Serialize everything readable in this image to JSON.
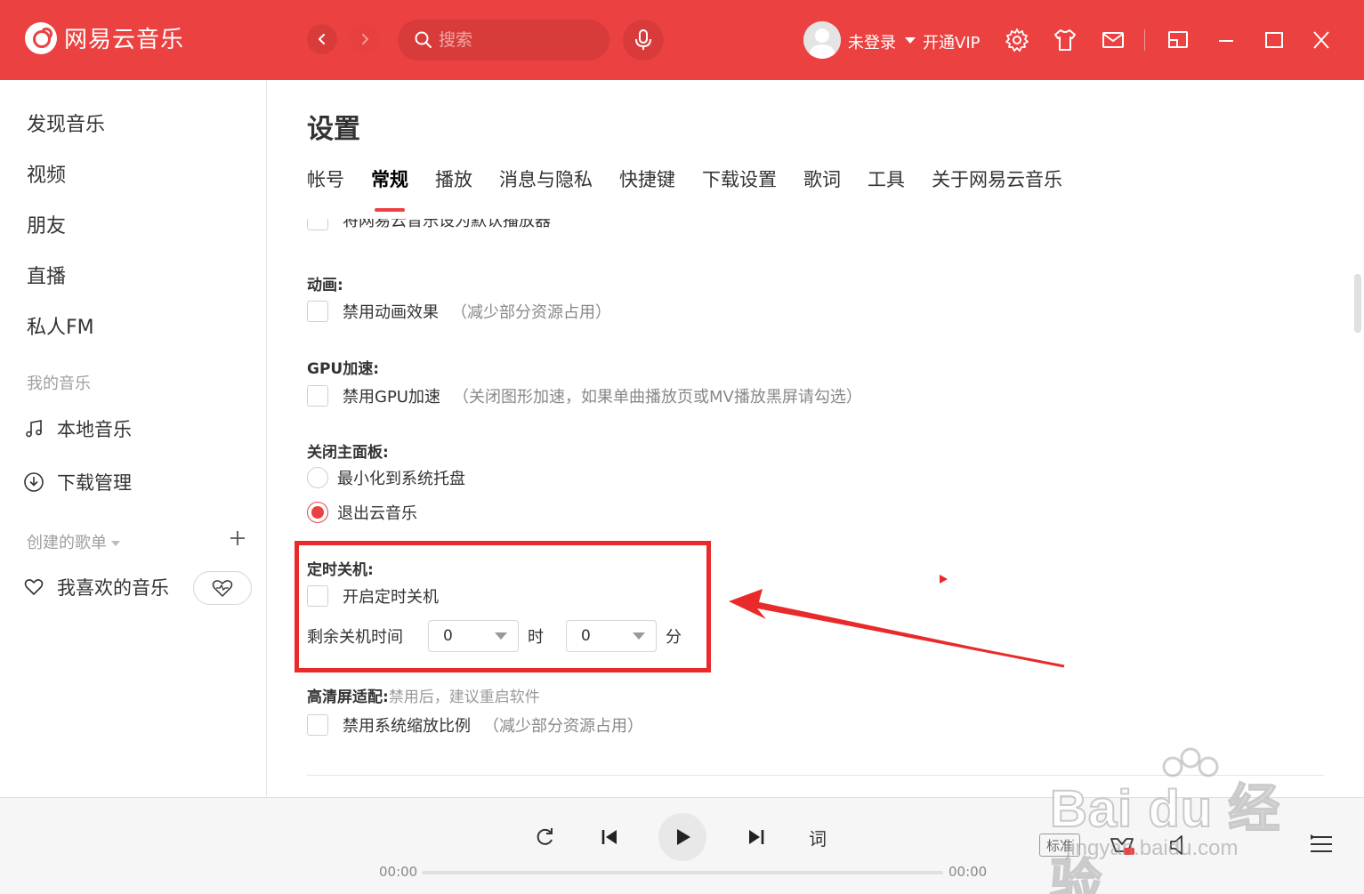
{
  "app": {
    "name": "网易云音乐"
  },
  "search": {
    "placeholder": "搜索"
  },
  "user": {
    "login_label": "未登录",
    "vip_label": "开通VIP"
  },
  "sidebar": {
    "main_items": [
      {
        "label": "发现音乐"
      },
      {
        "label": "视频"
      },
      {
        "label": "朋友"
      },
      {
        "label": "直播"
      },
      {
        "label": "私人FM"
      }
    ],
    "my_music_header": "我的音乐",
    "my_music_items": [
      {
        "label": "本地音乐",
        "icon": "music-note-icon"
      },
      {
        "label": "下载管理",
        "icon": "download-icon"
      }
    ],
    "playlists_header": "创建的歌单",
    "liked_label": "我喜欢的音乐"
  },
  "settings": {
    "title": "设置",
    "tabs": [
      {
        "label": "帐号",
        "active": false
      },
      {
        "label": "常规",
        "active": true
      },
      {
        "label": "播放",
        "active": false
      },
      {
        "label": "消息与隐私",
        "active": false
      },
      {
        "label": "快捷键",
        "active": false
      },
      {
        "label": "下载设置",
        "active": false
      },
      {
        "label": "歌词",
        "active": false
      },
      {
        "label": "工具",
        "active": false
      },
      {
        "label": "关于网易云音乐",
        "active": false
      }
    ],
    "clipped_option": "将网易云音乐设为默认播放器",
    "animation": {
      "label": "动画:",
      "option": "禁用动画效果",
      "hint": "（减少部分资源占用）",
      "checked": false
    },
    "gpu": {
      "label": "GPU加速:",
      "option": "禁用GPU加速",
      "hint": "（关闭图形加速，如果单曲播放页或MV播放黑屏请勾选）",
      "checked": false
    },
    "close_panel": {
      "label": "关闭主面板:",
      "options": [
        {
          "label": "最小化到系统托盘",
          "selected": false
        },
        {
          "label": "退出云音乐",
          "selected": true
        }
      ]
    },
    "shutdown_timer": {
      "label": "定时关机:",
      "option": "开启定时关机",
      "checked": false,
      "remaining_label": "剩余关机时间",
      "hours_value": "0",
      "hours_unit": "时",
      "minutes_value": "0",
      "minutes_unit": "分"
    },
    "hd_screen": {
      "label": "高清屏适配:",
      "label_hint": "禁用后，建议重启软件",
      "option": "禁用系统缩放比例",
      "hint": "（减少部分资源占用）",
      "checked": false
    }
  },
  "player": {
    "lyric_label": "词",
    "time_current": "00:00",
    "time_total": "00:00",
    "progress": 0,
    "quality_label": "标准"
  },
  "watermark": {
    "brand": "Bai du 经验",
    "url": "jingyan.baidu.com"
  },
  "colors": {
    "brand_red": "#ec4141",
    "highlight_red": "#ea2a2a"
  }
}
